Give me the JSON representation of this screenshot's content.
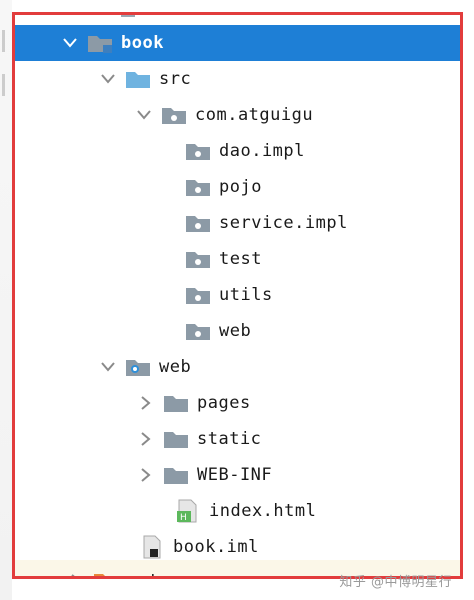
{
  "tree": {
    "rows": [
      {
        "label": "book",
        "icon": "module-folder-icon",
        "expanded": true,
        "selected": true
      },
      {
        "label": "src",
        "icon": "source-folder-icon",
        "expanded": true
      },
      {
        "label": "com.atguigu",
        "icon": "package-icon",
        "expanded": true
      },
      {
        "label": "dao.impl",
        "icon": "package-icon"
      },
      {
        "label": "pojo",
        "icon": "package-icon"
      },
      {
        "label": "service.impl",
        "icon": "package-icon"
      },
      {
        "label": "test",
        "icon": "package-icon"
      },
      {
        "label": "utils",
        "icon": "package-icon"
      },
      {
        "label": "web",
        "icon": "package-icon"
      },
      {
        "label": "web",
        "icon": "web-folder-icon",
        "expanded": true
      },
      {
        "label": "pages",
        "icon": "folder-icon",
        "expanded": false
      },
      {
        "label": "static",
        "icon": "folder-icon",
        "expanded": false
      },
      {
        "label": "WEB-INF",
        "icon": "folder-icon",
        "expanded": false
      },
      {
        "label": "index.html",
        "icon": "html-file-icon"
      },
      {
        "label": "book.iml",
        "icon": "iml-file-icon"
      },
      {
        "label": "out",
        "icon": "orange-folder-icon",
        "expanded": false
      }
    ]
  },
  "watermark": "知乎 @中博明星行",
  "colors": {
    "selection": "#1e7fd6",
    "frame_border": "#e23c3c",
    "folder_grey": "#8c9aa6",
    "source_folder_blue": "#6fb3e0",
    "orange_folder": "#e8883a"
  }
}
